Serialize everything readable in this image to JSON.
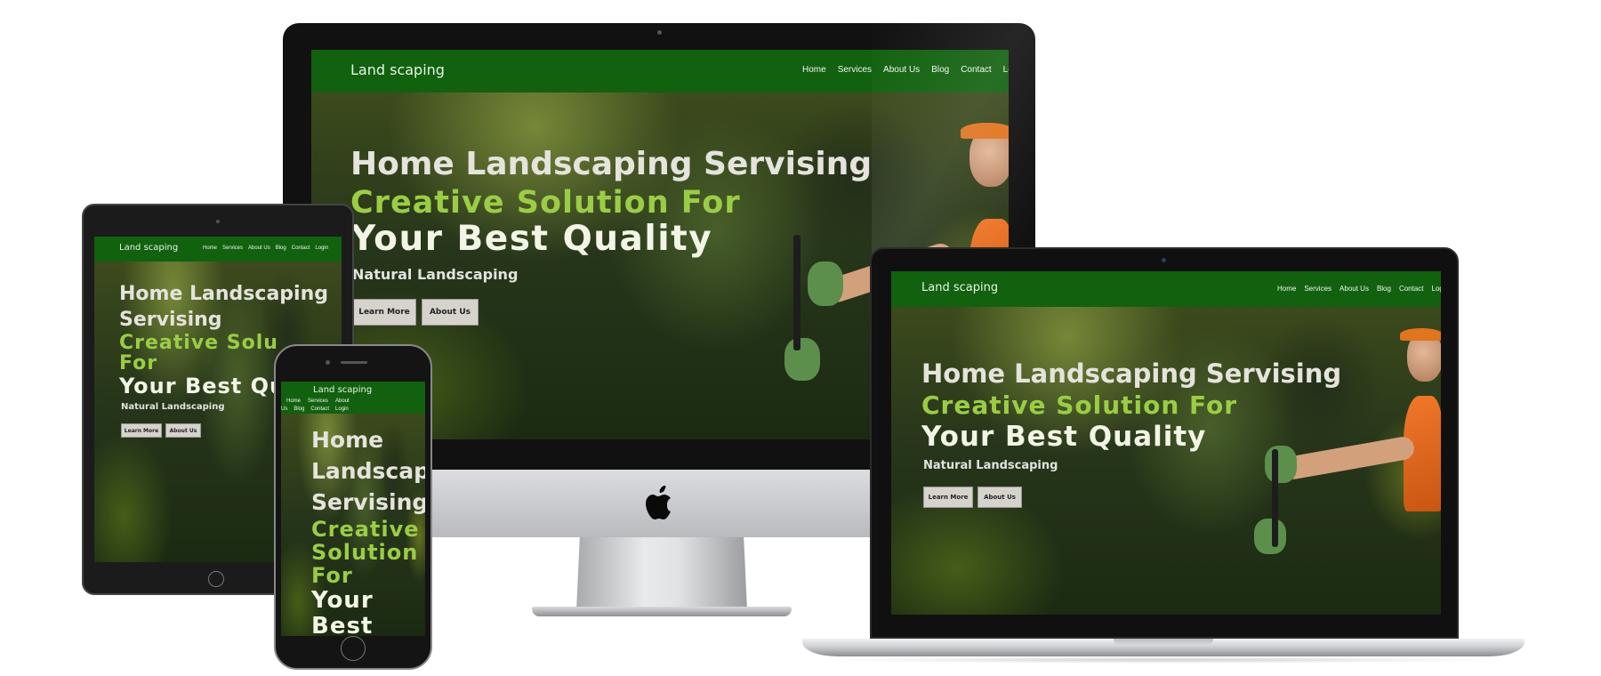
{
  "site": {
    "brand": "Land scaping",
    "nav": [
      "Home",
      "Services",
      "About Us",
      "Blog",
      "Contact",
      "Login"
    ],
    "hero": {
      "line1": "Home Landscaping Servising",
      "line2": "Creative Solution For",
      "line3": "Your Best Quality",
      "line4": "Natural Landscaping",
      "btn_primary": "Learn More",
      "btn_secondary": "About Us"
    }
  },
  "tablet": {
    "line1a": "Home Landscaping",
    "line1b": "Servising",
    "line2a": "Creative Solu",
    "line2b": "For",
    "line3": "Your Best Qu"
  },
  "phone": {
    "nav_row1": [
      "Home",
      "Services",
      "About"
    ],
    "nav_row2": [
      "Us",
      "Blog",
      "Contact",
      "Login"
    ],
    "lines": [
      "Home",
      "Landscap",
      "Servising",
      "Creative",
      "Solution",
      "For",
      "Your",
      "Best"
    ]
  },
  "colors": {
    "nav_bg": "#11610f",
    "accent_green": "#9acd45",
    "hero_white": "#f2f5e6"
  },
  "icons": {
    "apple_logo": "apple-icon"
  }
}
